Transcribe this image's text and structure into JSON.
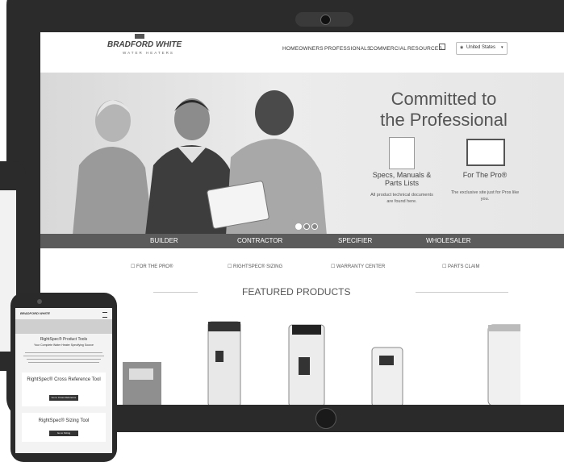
{
  "brand": {
    "name": "BRADFORD WHITE",
    "tagline": "WATER HEATERS"
  },
  "nav": {
    "items": [
      "HOMEOWNERS",
      "PROFESSIONALS",
      "COMMERCIAL",
      "RESOURCES"
    ],
    "country": "United States"
  },
  "hero": {
    "headline_line1": "Committed to",
    "headline_line2": "the Professional",
    "col1_title": "Specs, Manuals & Parts Lists",
    "col1_text": "All product technical documents are found here.",
    "col2_title": "For The Pro®",
    "col2_text": "The exclusive site just for Pros like you.",
    "slides": 3
  },
  "segments": [
    "BUILDER",
    "CONTRACTOR",
    "SPECIFIER",
    "WHOLESALER"
  ],
  "quick_links": [
    "FOR THE PRO®",
    "RIGHTSPEC® SIZING",
    "WARRANTY CENTER",
    "PARTS CLAIM"
  ],
  "featured": {
    "title": "FEATURED PRODUCTS"
  },
  "phone": {
    "heading": "RightSpec® Product Tools",
    "intro": "Your Complete Water Heater Specifying Source",
    "card1_title": "RightSpec® Cross Reference Tool",
    "card1_button": "Go to Cross Reference",
    "card2_title": "RightSpec® Sizing Tool",
    "card2_button": "Go to Sizing"
  },
  "colors": {
    "bar": "#5b5b5b",
    "bezel": "#2b2b2b"
  }
}
